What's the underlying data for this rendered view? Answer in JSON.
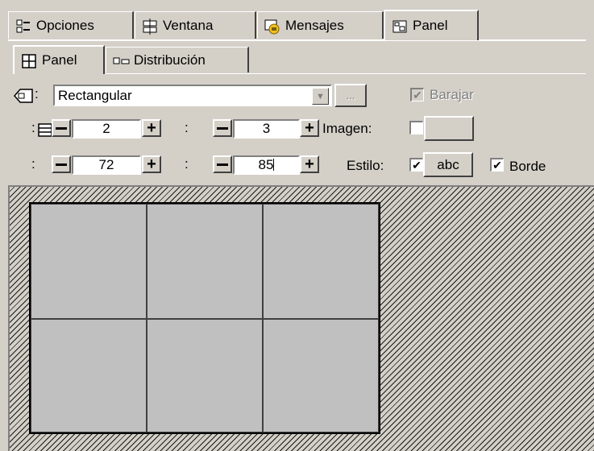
{
  "tabs_main": [
    {
      "label": "Opciones",
      "icon": "options-icon",
      "active": false
    },
    {
      "label": "Ventana",
      "icon": "window-icon",
      "active": false
    },
    {
      "label": "Mensajes",
      "icon": "messages-icon",
      "active": false
    },
    {
      "label": "Panel",
      "icon": "panel-icon",
      "active": true
    }
  ],
  "tabs_sub": [
    {
      "label": "Panel",
      "icon": "grid-icon",
      "active": true
    },
    {
      "label": "Distribución",
      "icon": "distribution-icon",
      "active": false
    }
  ],
  "shape": {
    "label_suffix": ":",
    "value": "Rectangular",
    "ellipsis_label": "...",
    "shuffle_label": "Barajar",
    "shuffle_checked": true,
    "shuffle_enabled": false
  },
  "rows": {
    "label_suffix": ":",
    "value": "2"
  },
  "cols": {
    "label_suffix": ":",
    "value": "3"
  },
  "image": {
    "label": "Imagen:",
    "checked": false
  },
  "width": {
    "label_suffix": ":",
    "value": "72"
  },
  "height": {
    "label_suffix": ":",
    "value": "85"
  },
  "style": {
    "label": "Estilo:",
    "checked": true,
    "button_label": "abc"
  },
  "border": {
    "label": "Borde",
    "checked": true
  },
  "preview": {
    "rows": 2,
    "cols": 3
  }
}
